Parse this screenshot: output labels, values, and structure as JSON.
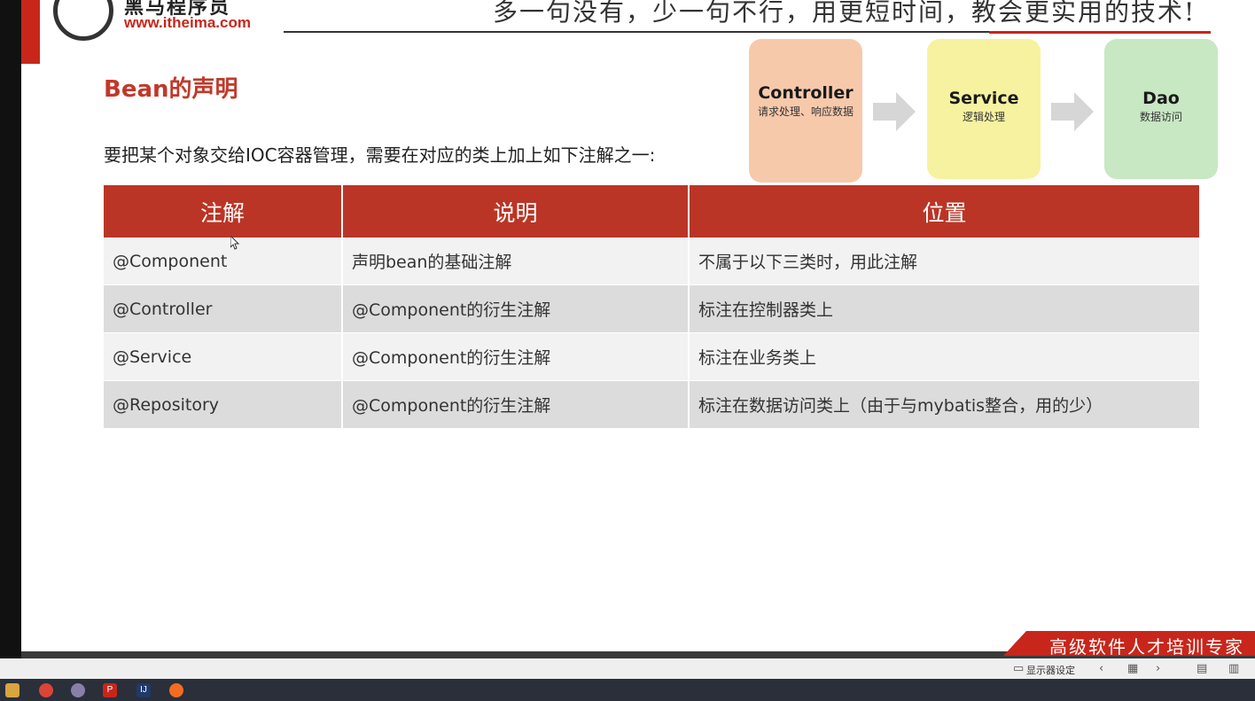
{
  "header": {
    "brand_name": "黑马程序员",
    "brand_url": "www.itheima.com",
    "slogan": "多一句没有，少一句不行，用更短时间，教会更实用的技术!"
  },
  "slide": {
    "title": "Bean的声明",
    "subtitle": "要把某个对象交给IOC容器管理，需要在对应的类上加上如下注解之一:"
  },
  "flow": [
    {
      "name": "Controller",
      "desc": "请求处理、响应数据",
      "color": "#f7c9ab"
    },
    {
      "name": "Service",
      "desc": "逻辑处理",
      "color": "#f7f2a0"
    },
    {
      "name": "Dao",
      "desc": "数据访问",
      "color": "#c8e7c3"
    }
  ],
  "table": {
    "headers": [
      "注解",
      "说明",
      "位置"
    ],
    "rows": [
      [
        "@Component",
        "声明bean的基础注解",
        "不属于以下三类时，用此注解"
      ],
      [
        "@Controller",
        "@Component的衍生注解",
        "标注在控制器类上"
      ],
      [
        "@Service",
        "@Component的衍生注解",
        "标注在业务类上"
      ],
      [
        "@Repository",
        "@Component的衍生注解",
        "标注在数据访问类上（由于与mybatis整合，用的少）"
      ]
    ],
    "header_color": "#bb3526"
  },
  "footer": {
    "banner": "高级软件人才培训专家"
  },
  "statusbar": {
    "display_settings": "显示器设定"
  },
  "colors": {
    "accent_red": "#c8261b",
    "title_red": "#c0392b"
  }
}
